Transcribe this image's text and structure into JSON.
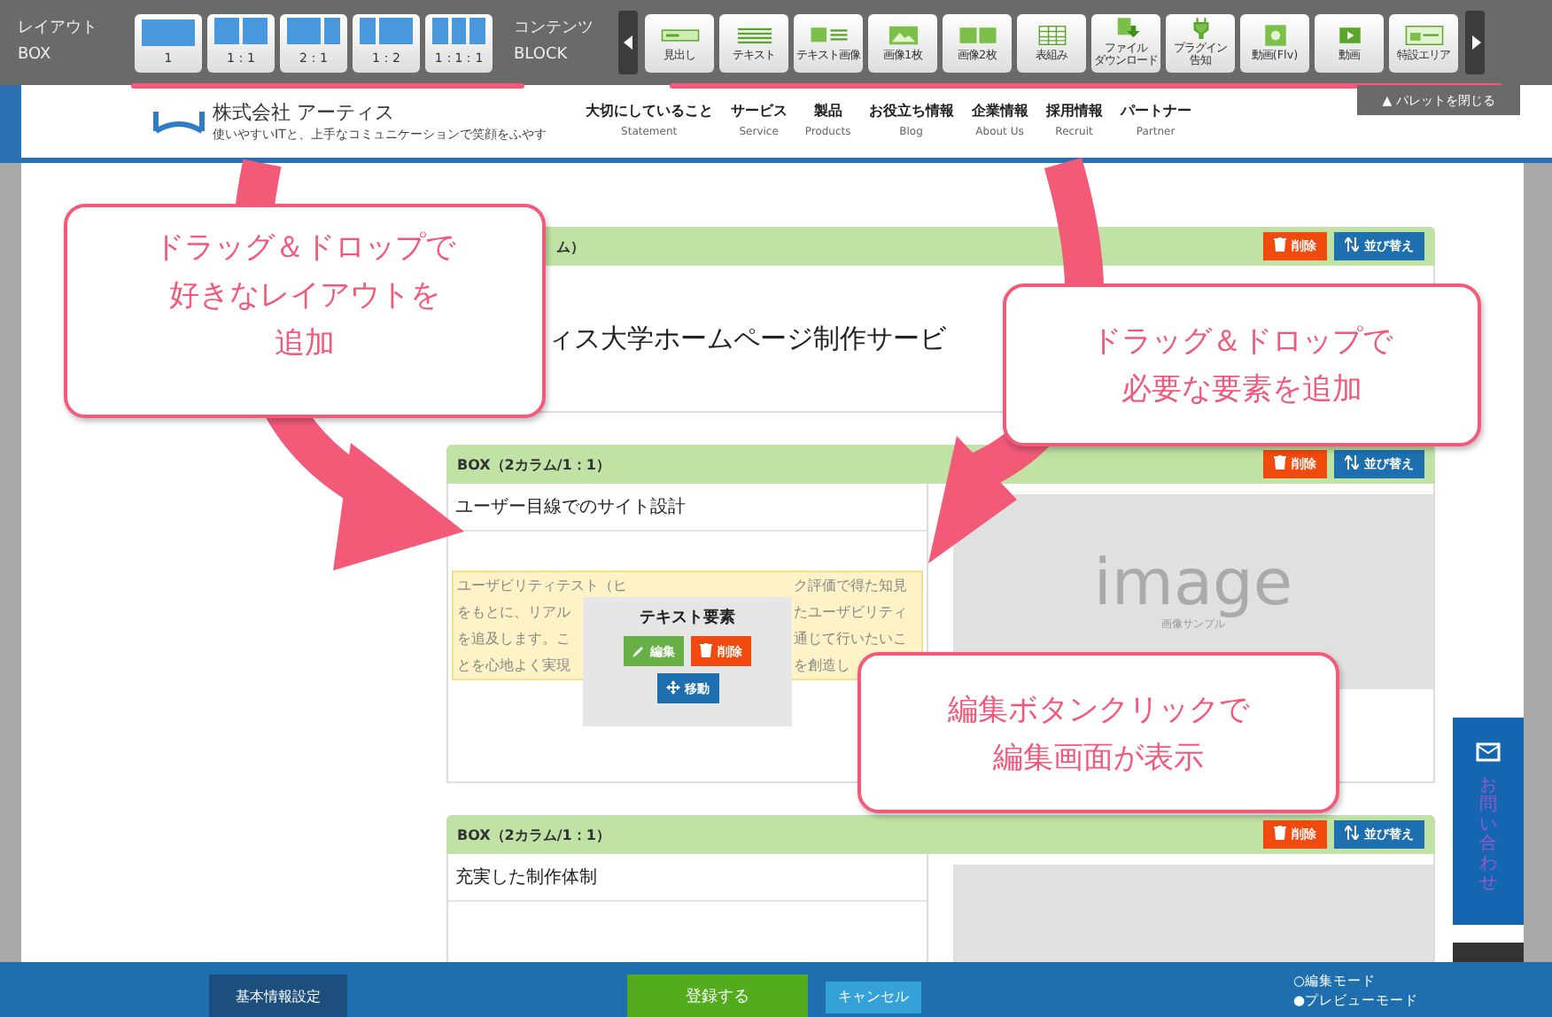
{
  "toolbar": {
    "layout_group": {
      "label": "レイアウト",
      "sublabel": "BOX",
      "buttons": [
        {
          "label": "1"
        },
        {
          "label": "1：1"
        },
        {
          "label": "2：1"
        },
        {
          "label": "1：2"
        },
        {
          "label": "1：1：1"
        }
      ]
    },
    "content_group": {
      "label": "コンテンツ",
      "sublabel": "BLOCK",
      "buttons": [
        {
          "lines": [
            "見出し"
          ],
          "kind": "heading"
        },
        {
          "lines": [
            "テキスト"
          ],
          "kind": "text"
        },
        {
          "lines": [
            "テキスト画像"
          ],
          "kind": "text-image"
        },
        {
          "lines": [
            "画像1枚"
          ],
          "kind": "image"
        },
        {
          "lines": [
            "画像2枚"
          ],
          "kind": "images"
        },
        {
          "lines": [
            "表組み"
          ],
          "kind": "table"
        },
        {
          "lines": [
            "ファイル",
            "ダウンロード"
          ],
          "kind": "download"
        },
        {
          "lines": [
            "プラグイン",
            "告知"
          ],
          "kind": "plugin"
        },
        {
          "lines": [
            "動画(Flv)"
          ],
          "kind": "film"
        },
        {
          "lines": [
            "動画"
          ],
          "kind": "video"
        },
        {
          "lines": [
            "特設エリア"
          ],
          "kind": "special"
        }
      ]
    }
  },
  "header": {
    "company": "株式会社 アーティス",
    "tagline": "使いやすいITと、上手なコミュニケーションで笑顔をふやす",
    "nav": [
      {
        "label": "大切にしていること",
        "sub": "Statement"
      },
      {
        "label": "サービス",
        "sub": "Service"
      },
      {
        "label": "製品",
        "sub": "Products"
      },
      {
        "label": "お役立ち情報",
        "sub": "Blog"
      },
      {
        "label": "企業情報",
        "sub": "About Us"
      },
      {
        "label": "採用情報",
        "sub": "Recruit"
      },
      {
        "label": "パートナー",
        "sub": "Partner"
      }
    ]
  },
  "palette_close": "▲ パレットを閉じる",
  "boxes": [
    {
      "kind": "one",
      "title": "ム）",
      "delete": "削除",
      "sort": "並び替え",
      "heading": "ィス大学ホームページ制作サービ"
    },
    {
      "kind": "two",
      "title": "BOX（2カラム/1：1）",
      "delete": "削除",
      "sort": "並び替え",
      "heading": "ユーザー目線でのサイト設計",
      "paragraph": [
        [
          "ユーザビリティテスト（ヒ",
          "ク評価で得た知見"
        ],
        [
          "をもとに、リアル",
          "たユーザビリティ"
        ],
        [
          "を追及します。こ",
          "通じて行いたいこ"
        ],
        [
          "とを心地よく実現",
          "を創造し"
        ]
      ],
      "image_word": "image",
      "image_caption": "画像サンプル"
    },
    {
      "kind": "two",
      "title": "BOX（2カラム/1：1）",
      "delete": "削除",
      "sort": "並び替え",
      "heading": "充実した制作体制"
    }
  ],
  "popup": {
    "title": "テキスト要素",
    "edit": "編集",
    "delete": "削除",
    "move": "移動"
  },
  "callouts": [
    {
      "lines": [
        "ドラッグ＆ドロップで",
        "好きなレイアウトを",
        "追加"
      ]
    },
    {
      "lines": [
        "ドラッグ＆ドロップで",
        "必要な要素を追加"
      ]
    },
    {
      "lines": [
        "編集ボタンクリックで",
        "編集画面が表示"
      ]
    }
  ],
  "side_tab": {
    "label": "お問い合わせ"
  },
  "footer": {
    "settings": "基本情報設定",
    "submit": "登録する",
    "cancel": "キャンセル",
    "modes": [
      "○編集モード",
      "●プレビューモード"
    ]
  }
}
